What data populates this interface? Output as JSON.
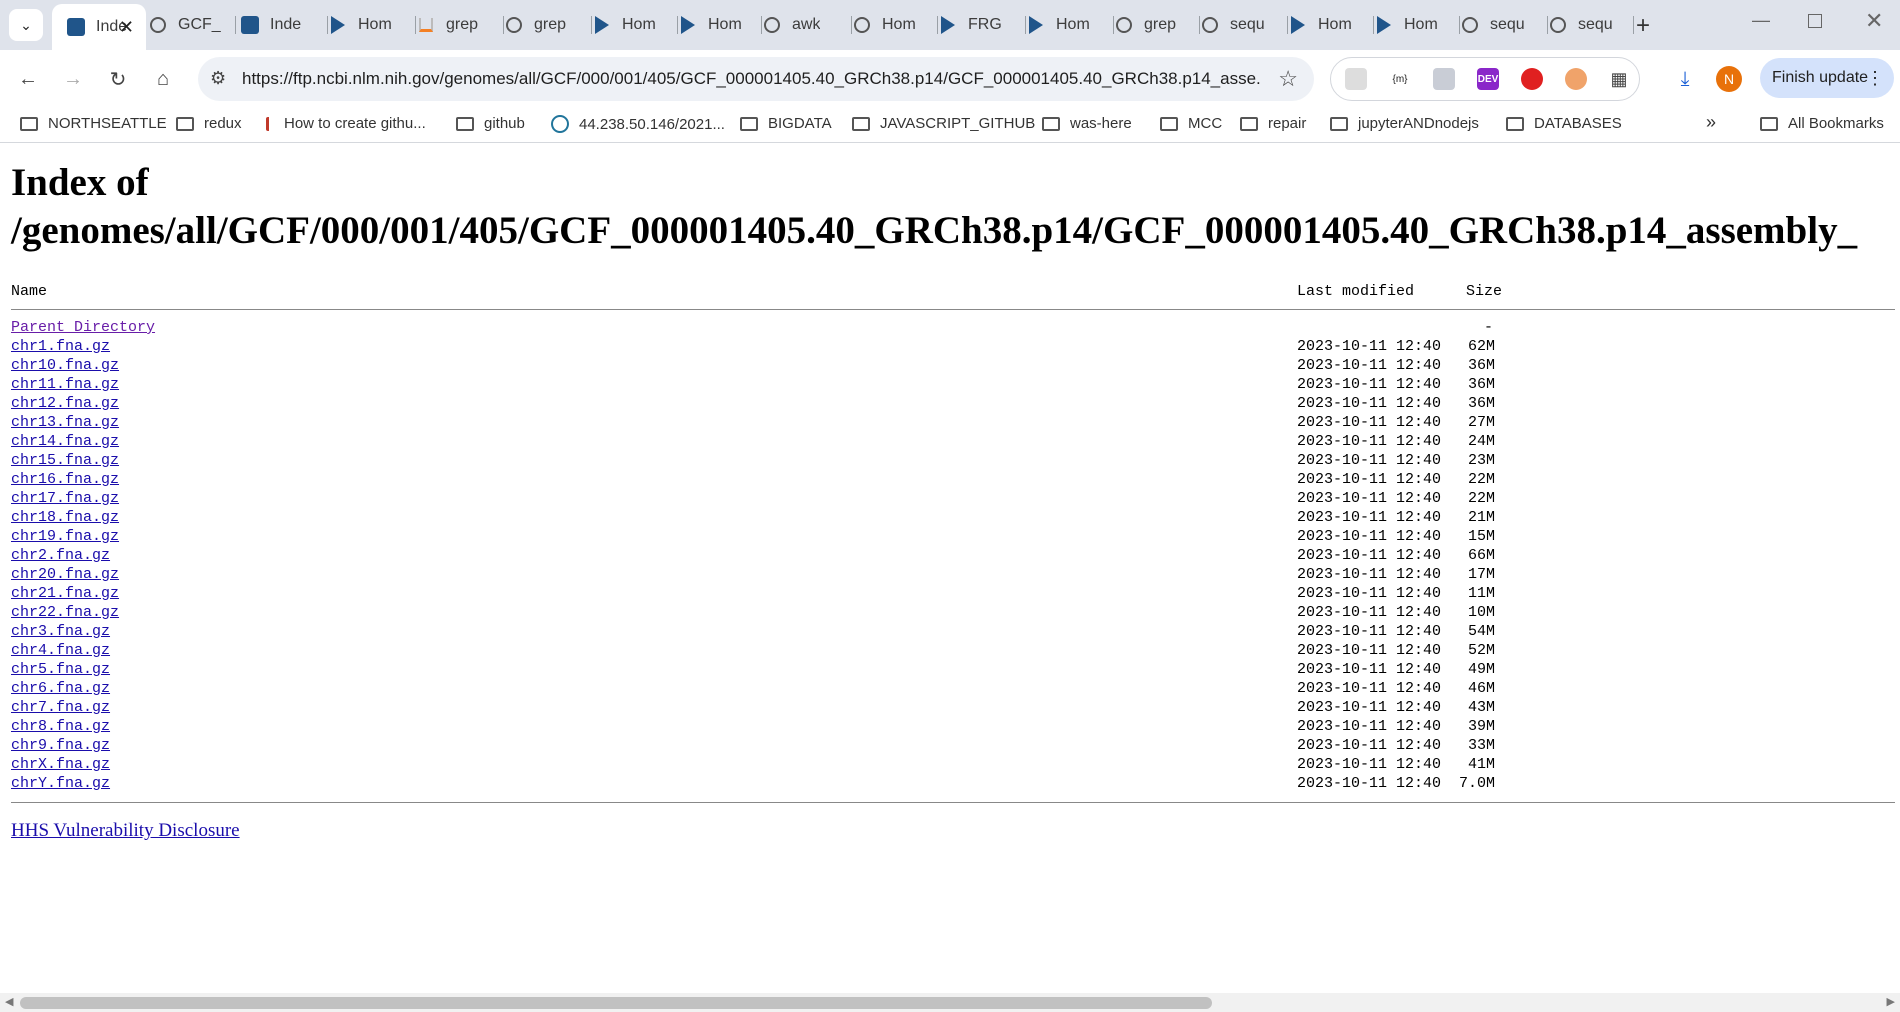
{
  "browser": {
    "tabs": [
      {
        "label": "GCF_",
        "icon": "globe-icon"
      },
      {
        "label": "Inde",
        "icon": "ncbi-icon",
        "active": true
      },
      {
        "label": "Inde",
        "icon": "ncbi-icon"
      },
      {
        "label": "Hom",
        "icon": "bookmark-arrow-icon"
      },
      {
        "label": "grep",
        "icon": "stackoverflow-icon"
      },
      {
        "label": "grep",
        "icon": "globe-icon"
      },
      {
        "label": "Hom",
        "icon": "bookmark-arrow-icon"
      },
      {
        "label": "Hom",
        "icon": "bookmark-arrow-icon"
      },
      {
        "label": "awk",
        "icon": "globe-icon"
      },
      {
        "label": "Hom",
        "icon": "globe-icon"
      },
      {
        "label": "FRG",
        "icon": "bookmark-arrow-icon"
      },
      {
        "label": "Hom",
        "icon": "bookmark-arrow-icon"
      },
      {
        "label": "grep",
        "icon": "globe-icon"
      },
      {
        "label": "sequ",
        "icon": "globe-icon"
      },
      {
        "label": "Hom",
        "icon": "bookmark-arrow-icon"
      },
      {
        "label": "Hom",
        "icon": "bookmark-arrow-icon"
      },
      {
        "label": "sequ",
        "icon": "globe-icon"
      },
      {
        "label": "sequ",
        "icon": "globe-icon"
      }
    ],
    "url": "https://ftp.ncbi.nlm.nih.gov/genomes/all/GCF/000/001/405/GCF_000001405.40_GRCh38.p14/GCF_000001405.40_GRCh38.p14_asse...",
    "profile_initial": "N",
    "finish_update_label": "Finish update",
    "extension_dev_label": "DEV",
    "extension_braces_label": "{m}",
    "bookmarks": [
      "NORTHSEATTLE",
      "redux",
      "How to create githu...",
      "github",
      "44.238.50.146/2021...",
      "BIGDATA",
      "JAVASCRIPT_GITHUB",
      "was-here",
      "MCC",
      "repair",
      "jupyterANDnodejs",
      "DATABASES"
    ],
    "all_bookmarks_label": "All Bookmarks",
    "overflow_label": "»"
  },
  "page": {
    "title_line1": "Index of",
    "title_line2": "/genomes/all/GCF/000/001/405/GCF_000001405.40_GRCh38.p14/GCF_000001405.40_GRCh38.p14_assembly_",
    "columns": {
      "name": "Name",
      "last_modified": "Last modified",
      "size": "Size"
    },
    "parent": {
      "name": "Parent Directory",
      "size": "-"
    },
    "files": [
      {
        "name": "chr1.fna.gz",
        "modified": "2023-10-11 12:40",
        "size": "62M"
      },
      {
        "name": "chr10.fna.gz",
        "modified": "2023-10-11 12:40",
        "size": "36M"
      },
      {
        "name": "chr11.fna.gz",
        "modified": "2023-10-11 12:40",
        "size": "36M"
      },
      {
        "name": "chr12.fna.gz",
        "modified": "2023-10-11 12:40",
        "size": "36M"
      },
      {
        "name": "chr13.fna.gz",
        "modified": "2023-10-11 12:40",
        "size": "27M"
      },
      {
        "name": "chr14.fna.gz",
        "modified": "2023-10-11 12:40",
        "size": "24M"
      },
      {
        "name": "chr15.fna.gz",
        "modified": "2023-10-11 12:40",
        "size": "23M"
      },
      {
        "name": "chr16.fna.gz",
        "modified": "2023-10-11 12:40",
        "size": "22M"
      },
      {
        "name": "chr17.fna.gz",
        "modified": "2023-10-11 12:40",
        "size": "22M"
      },
      {
        "name": "chr18.fna.gz",
        "modified": "2023-10-11 12:40",
        "size": "21M"
      },
      {
        "name": "chr19.fna.gz",
        "modified": "2023-10-11 12:40",
        "size": "15M"
      },
      {
        "name": "chr2.fna.gz",
        "modified": "2023-10-11 12:40",
        "size": "66M"
      },
      {
        "name": "chr20.fna.gz",
        "modified": "2023-10-11 12:40",
        "size": "17M"
      },
      {
        "name": "chr21.fna.gz",
        "modified": "2023-10-11 12:40",
        "size": "11M"
      },
      {
        "name": "chr22.fna.gz",
        "modified": "2023-10-11 12:40",
        "size": "10M"
      },
      {
        "name": "chr3.fna.gz",
        "modified": "2023-10-11 12:40",
        "size": "54M"
      },
      {
        "name": "chr4.fna.gz",
        "modified": "2023-10-11 12:40",
        "size": "52M"
      },
      {
        "name": "chr5.fna.gz",
        "modified": "2023-10-11 12:40",
        "size": "49M"
      },
      {
        "name": "chr6.fna.gz",
        "modified": "2023-10-11 12:40",
        "size": "46M"
      },
      {
        "name": "chr7.fna.gz",
        "modified": "2023-10-11 12:40",
        "size": "43M"
      },
      {
        "name": "chr8.fna.gz",
        "modified": "2023-10-11 12:40",
        "size": "39M"
      },
      {
        "name": "chr9.fna.gz",
        "modified": "2023-10-11 12:40",
        "size": "33M"
      },
      {
        "name": "chrX.fna.gz",
        "modified": "2023-10-11 12:40",
        "size": "41M"
      },
      {
        "name": "chrY.fna.gz",
        "modified": "2023-10-11 12:40",
        "size": "7.0M"
      }
    ],
    "footer_link": "HHS Vulnerability Disclosure"
  },
  "colors": {
    "link": "#1a0dab",
    "visited": "#681da8",
    "tabstrip": "#dfe3eb",
    "accent": "#d4e2fb"
  }
}
